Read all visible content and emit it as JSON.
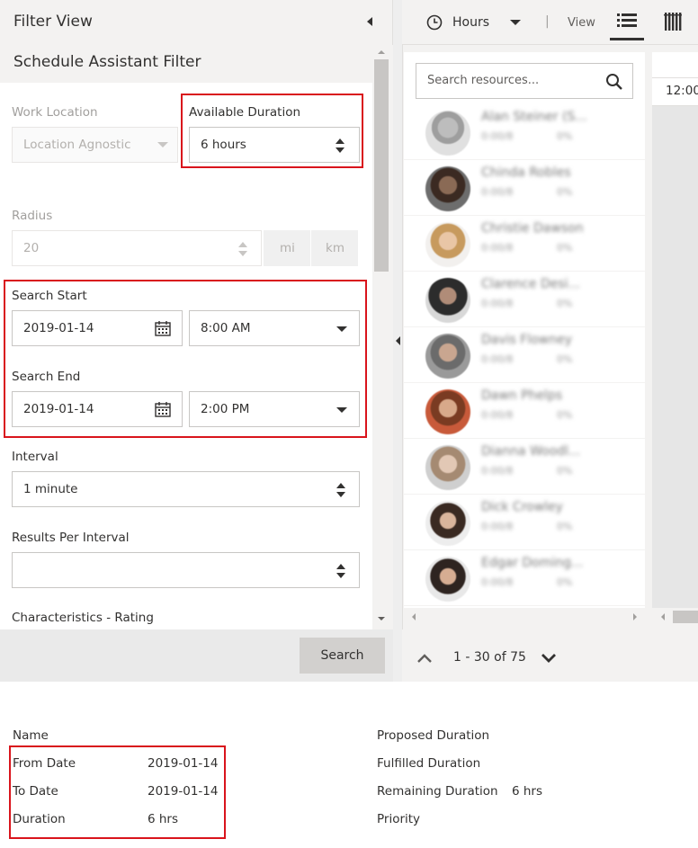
{
  "filter_view": {
    "title": "Filter View",
    "subtitle": "Schedule Assistant Filter",
    "work_location": {
      "label": "Work Location",
      "value": "Location Agnostic"
    },
    "available_duration": {
      "label": "Available Duration",
      "value": "6 hours"
    },
    "radius": {
      "label": "Radius",
      "value": "20",
      "unit_mi": "mi",
      "unit_km": "km"
    },
    "search_start": {
      "label": "Search Start",
      "date": "2019-01-14",
      "time": "8:00 AM"
    },
    "search_end": {
      "label": "Search End",
      "date": "2019-01-14",
      "time": "2:00 PM"
    },
    "interval": {
      "label": "Interval",
      "value": "1 minute"
    },
    "results_per_interval": {
      "label": "Results Per Interval",
      "value": ""
    },
    "characteristics": {
      "label": "Characteristics - Rating"
    },
    "search_button": "Search"
  },
  "resource_panel": {
    "toolbar": {
      "hours_label": "Hours",
      "separator": "|",
      "view_label": "View"
    },
    "search_placeholder": "Search resources...",
    "time_header": "12:00",
    "resources": [
      {
        "name": "Alan Steiner (S...",
        "meta": "0:00/8",
        "pct": "0%"
      },
      {
        "name": "Chinda Robles",
        "meta": "0:00/8",
        "pct": "0%"
      },
      {
        "name": "Christie Dawson",
        "meta": "0:00/8",
        "pct": "0%"
      },
      {
        "name": "Clarence Desi...",
        "meta": "0:00/8",
        "pct": "0%"
      },
      {
        "name": "Davis Flowney",
        "meta": "0:00/8",
        "pct": "0%"
      },
      {
        "name": "Dawn Phelps",
        "meta": "0:00/8",
        "pct": "0%"
      },
      {
        "name": "Dianna Woodl...",
        "meta": "0:00/8",
        "pct": "0%"
      },
      {
        "name": "Dick Crowley",
        "meta": "0:00/8",
        "pct": "0%"
      },
      {
        "name": "Edgar Doming...",
        "meta": "0:00/8",
        "pct": "0%"
      }
    ],
    "pager_text": "1 - 30 of 75"
  },
  "details": {
    "name_label": "Name",
    "from_date_label": "From Date",
    "from_date_value": "2019-01-14",
    "to_date_label": "To Date",
    "to_date_value": "2019-01-14",
    "duration_label": "Duration",
    "duration_value": "6 hrs",
    "proposed_duration_label": "Proposed Duration",
    "fulfilled_duration_label": "Fulfilled Duration",
    "remaining_duration_label": "Remaining Duration",
    "remaining_duration_value": "6 hrs",
    "priority_label": "Priority"
  },
  "colors": {
    "highlight": "#d9141c",
    "panel_bg": "#f3f2f1",
    "border": "#c8c6c4",
    "text": "#323130"
  },
  "icons": {
    "clock": "clock-icon",
    "dropdown": "caret-down-icon",
    "list_view": "list-view-icon",
    "column_view": "column-view-icon",
    "search": "search-icon",
    "calendar": "calendar-icon",
    "stepper": "stepper-icon",
    "collapse": "collapse-left-icon"
  }
}
